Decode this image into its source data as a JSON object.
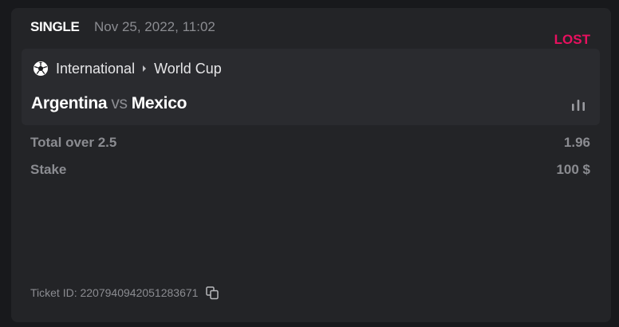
{
  "bet": {
    "type": "SINGLE",
    "date": "Nov 25, 2022, 11:02",
    "status": "LOST"
  },
  "event": {
    "icon": "soccer-ball-icon",
    "category": "International",
    "tournament": "World Cup",
    "home_team": "Argentina",
    "vs": "vs",
    "away_team": "Mexico",
    "stats_icon": "bar-chart-icon"
  },
  "selection": {
    "label": "Total over 2.5",
    "odds": "1.96"
  },
  "stake": {
    "label": "Stake",
    "value": "100 $"
  },
  "ticket": {
    "text": "Ticket ID: 2207940942051283671",
    "copy_icon": "copy-icon"
  },
  "colors": {
    "background": "#18191c",
    "card": "#232427",
    "event_box": "#2a2b2f",
    "status_lost": "#e8105f",
    "muted_text": "#8b8c91",
    "primary_text": "#ffffff"
  }
}
